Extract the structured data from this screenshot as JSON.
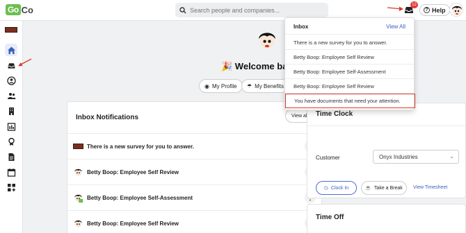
{
  "header": {
    "logo_go": "Go",
    "logo_co": "Co",
    "search_placeholder": "Search people and companies...",
    "inbox_badge": "12",
    "help_label": "Help"
  },
  "sidebar": {
    "items": [
      "home-icon",
      "inbox-icon",
      "profile-icon",
      "people-icon",
      "building-icon",
      "timesheet-icon",
      "award-icon",
      "document-icon",
      "calendar-icon",
      "apps-icon"
    ]
  },
  "main": {
    "welcome": "🎉 Welcome back",
    "my_profile": "My Profile",
    "my_benefits": "My Benefits"
  },
  "inbox_card": {
    "title": "Inbox Notifications",
    "view_all": "View all",
    "items": [
      "There is a new survey for you to answer.",
      "Betty Boop: Employee Self Review",
      "Betty Boop: Employee Self-Assessment",
      "Betty Boop: Employee Self Review"
    ]
  },
  "time_clock": {
    "title": "Time Clock",
    "customer_label": "Customer",
    "customer_value": "Onyx Industries",
    "clock_in": "Clock In",
    "take_break": "Take a Break",
    "view_timesheet": "View Timesheet"
  },
  "time_off": {
    "title": "Time Off"
  },
  "inbox_dropdown": {
    "title": "Inbox",
    "view_all": "View All",
    "items": [
      "There is a new survey for you to answer.",
      "Betty Boop: Employee Self Review",
      "Betty Boop: Employee Self-Assessment",
      "Betty Boop: Employee Self Review",
      "You have documents that need your attention."
    ]
  },
  "colors": {
    "accent": "#3a5fc1",
    "highlight": "#d93a2b",
    "badge": "#e53935",
    "logo_green": "#6bbf4e"
  }
}
